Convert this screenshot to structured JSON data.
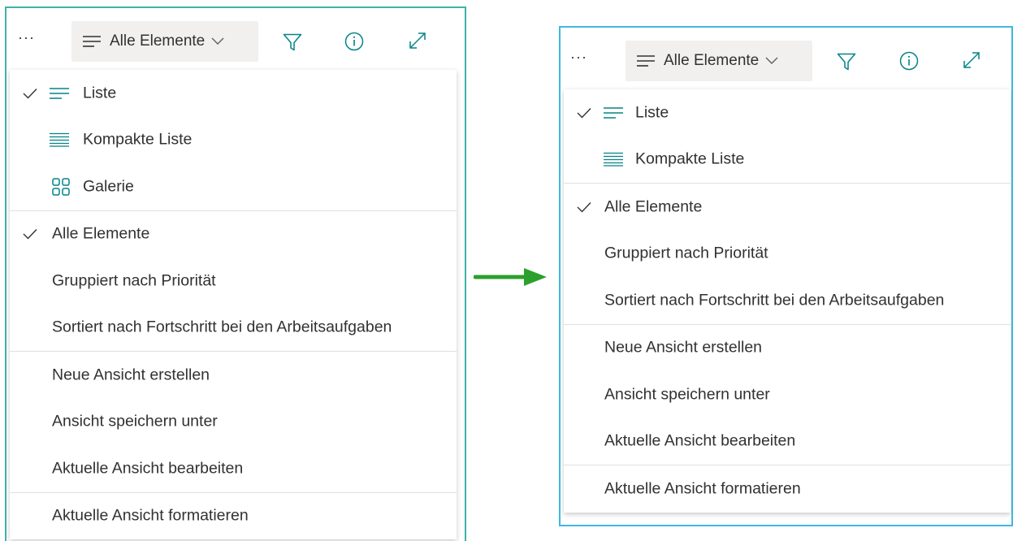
{
  "toolbar": {
    "more_glyph": "···",
    "view_label": "Alle Elemente",
    "icons": [
      "lines-icon",
      "chevron-down-icon",
      "filter-icon",
      "info-icon",
      "expand-icon"
    ]
  },
  "left_menu": {
    "layout_items": [
      {
        "label": "Liste",
        "checked": true,
        "icon": "list-icon"
      },
      {
        "label": "Kompakte Liste",
        "checked": false,
        "icon": "compact-list-icon"
      },
      {
        "label": "Galerie",
        "checked": false,
        "icon": "gallery-icon"
      }
    ],
    "view_items": [
      {
        "label": "Alle Elemente",
        "checked": true
      },
      {
        "label": "Gruppiert nach Priorität",
        "checked": false
      },
      {
        "label": "Sortiert nach Fortschritt bei den Arbeitsaufgaben",
        "checked": false
      }
    ],
    "action_items": [
      {
        "label": "Neue Ansicht erstellen"
      },
      {
        "label": "Ansicht speichern unter"
      },
      {
        "label": "Aktuelle Ansicht bearbeiten"
      }
    ],
    "format_item": {
      "label": "Aktuelle Ansicht formatieren"
    }
  },
  "right_menu": {
    "layout_items": [
      {
        "label": "Liste",
        "checked": true,
        "icon": "list-icon"
      },
      {
        "label": "Kompakte Liste",
        "checked": false,
        "icon": "compact-list-icon"
      }
    ],
    "view_items": [
      {
        "label": "Alle Elemente",
        "checked": true
      },
      {
        "label": "Gruppiert nach Priorität",
        "checked": false
      },
      {
        "label": "Sortiert nach Fortschritt bei den Arbeitsaufgaben",
        "checked": false
      }
    ],
    "action_items": [
      {
        "label": "Neue Ansicht erstellen"
      },
      {
        "label": "Ansicht speichern unter"
      },
      {
        "label": "Aktuelle Ansicht bearbeiten"
      }
    ],
    "format_item": {
      "label": "Aktuelle Ansicht formatieren"
    }
  },
  "colors": {
    "teal_icon": "#038387",
    "left_border": "#3fb2a7",
    "right_border": "#3fb8e0",
    "arrow": "#2ca02c",
    "text": "#323130",
    "divider": "#e1dfdd"
  }
}
